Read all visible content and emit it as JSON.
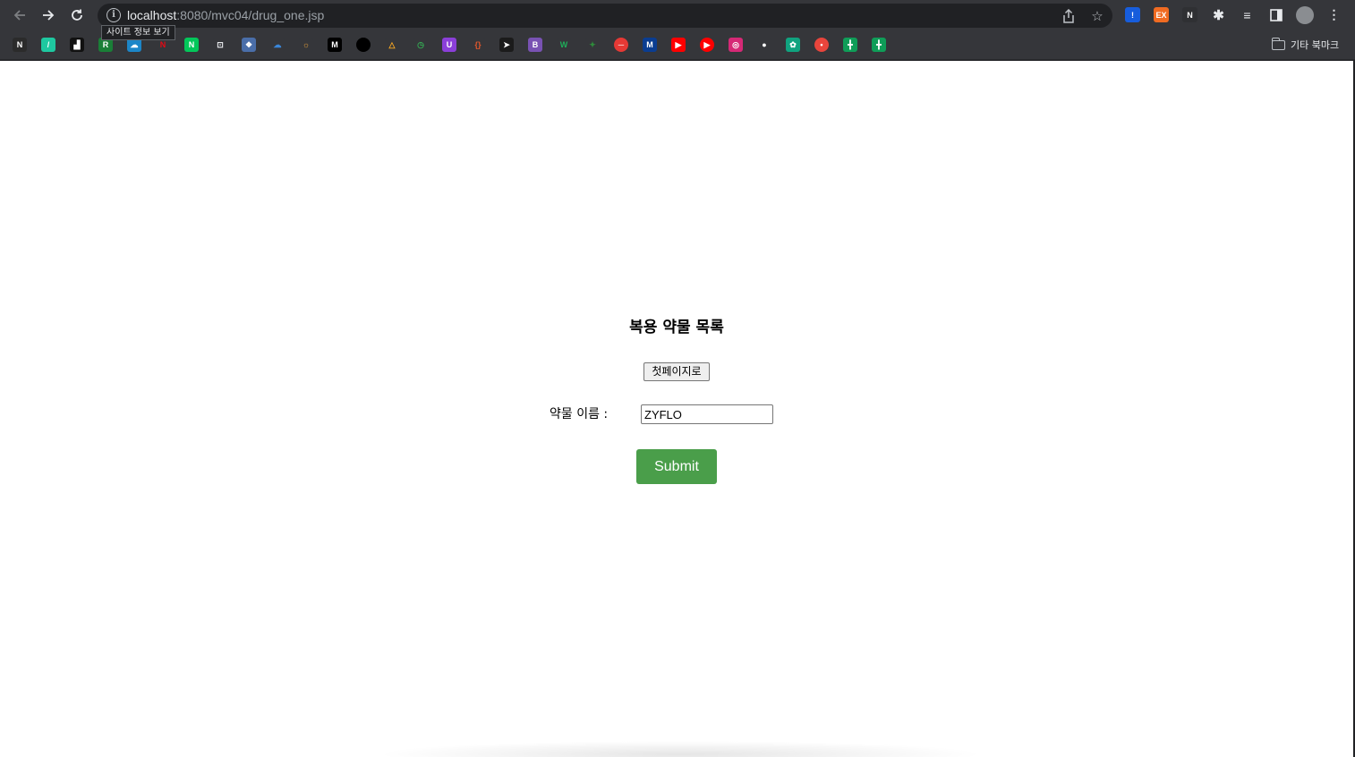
{
  "browser": {
    "url_host": "localhost",
    "url_rest": ":8080/mvc04/drug_one.jsp",
    "site_info_tooltip": "사이트 정보 보기",
    "other_bookmarks_label": "기타 북마크",
    "extensions": [
      {
        "name": "bitwarden-extension-icon",
        "color": "#175ddc",
        "glyph": "!"
      },
      {
        "name": "ex-extension-icon",
        "color": "#f06b22",
        "glyph": "EX"
      },
      {
        "name": "notion-extension-icon",
        "color": "#2f3033",
        "glyph": "N"
      }
    ],
    "bookmarks": [
      {
        "name": "bookmark-nx-icon",
        "color": "#2b2b2b",
        "glyph": "N"
      },
      {
        "name": "bookmark-slash-icon",
        "color": "#1ec8a0",
        "glyph": "/"
      },
      {
        "name": "bookmark-dark-icon",
        "color": "#111111",
        "glyph": "▟"
      },
      {
        "name": "bookmark-green-bracket-icon",
        "color": "#1a7f37",
        "glyph": "R"
      },
      {
        "name": "bookmark-cloud-icon",
        "color": "#1c86c8",
        "glyph": "☁"
      },
      {
        "name": "bookmark-netflix-icon",
        "color": "#35363a",
        "glyph": "N",
        "fg": "#e50914"
      },
      {
        "name": "bookmark-naver-icon",
        "color": "#03c75a",
        "glyph": "N"
      },
      {
        "name": "bookmark-square-icon",
        "color": "#35363a",
        "glyph": "⊡",
        "fg": "#e8eaed"
      },
      {
        "name": "bookmark-puzzle-icon",
        "color": "#4a6ea9",
        "glyph": "❖"
      },
      {
        "name": "bookmark-onedrive-icon",
        "color": "#35363a",
        "glyph": "☁",
        "fg": "#3a86d8"
      },
      {
        "name": "bookmark-sun-icon",
        "color": "#35363a",
        "glyph": "☼",
        "fg": "#e9a23b"
      },
      {
        "name": "bookmark-medium-icon",
        "color": "#000000",
        "glyph": "M"
      },
      {
        "name": "bookmark-dot-icon",
        "color": "#000000",
        "glyph": ""
      },
      {
        "name": "bookmark-triangle-icon",
        "color": "#35363a",
        "glyph": "△",
        "fg": "#f5a623"
      },
      {
        "name": "bookmark-clock-icon",
        "color": "#35363a",
        "glyph": "◷",
        "fg": "#35a853"
      },
      {
        "name": "bookmark-purple-icon",
        "color": "#8b3fd9",
        "glyph": "U"
      },
      {
        "name": "bookmark-braces-icon",
        "color": "#35363a",
        "glyph": "{}",
        "fg": "#e2572c"
      },
      {
        "name": "bookmark-bird-icon",
        "color": "#1b1b1b",
        "glyph": "➤"
      },
      {
        "name": "bookmark-bootstrap-icon",
        "color": "#7952b3",
        "glyph": "B"
      },
      {
        "name": "bookmark-w-icon",
        "color": "#35363a",
        "glyph": "W",
        "fg": "#1fae5a"
      },
      {
        "name": "bookmark-leaf-icon",
        "color": "#35363a",
        "glyph": "✦",
        "fg": "#2e8b3a"
      },
      {
        "name": "bookmark-red-circle-icon",
        "color": "#e53935",
        "glyph": "─",
        "round": true
      },
      {
        "name": "bookmark-m-blue-icon",
        "color": "#0a3d91",
        "glyph": "M"
      },
      {
        "name": "bookmark-youtube-icon",
        "color": "#ff0000",
        "glyph": "▶"
      },
      {
        "name": "bookmark-youtube-music-icon",
        "color": "#ff0000",
        "glyph": "▶",
        "round": true
      },
      {
        "name": "bookmark-instagram-icon",
        "color": "#d62976",
        "glyph": "◎"
      },
      {
        "name": "bookmark-github-icon",
        "color": "#35363a",
        "glyph": "●",
        "fg": "#ffffff"
      },
      {
        "name": "bookmark-openai-icon",
        "color": "#10a37f",
        "glyph": "✿"
      },
      {
        "name": "bookmark-red-dot-icon",
        "color": "#e8453c",
        "glyph": "•",
        "round": true
      },
      {
        "name": "bookmark-sheets-icon-1",
        "color": "#0f9d58",
        "glyph": "╋"
      },
      {
        "name": "bookmark-sheets-icon-2",
        "color": "#0f9d58",
        "glyph": "╋"
      }
    ]
  },
  "page": {
    "title": "복용 약물 목록",
    "first_page_button": "첫페이지로",
    "drug_name_label": "약물 이름 :",
    "drug_name_value": "ZYFLO",
    "submit_button": "Submit"
  }
}
